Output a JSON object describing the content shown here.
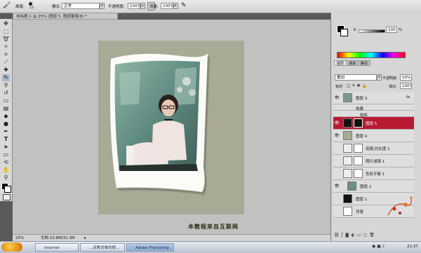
{
  "options_bar": {
    "brush_label": "画笔:",
    "brush_size": "13",
    "mode_label": "模式:",
    "mode_value": "正常",
    "opacity_label": "不透明度:",
    "opacity_value": "100%",
    "flow_label": "流量:",
    "flow_value": "100%"
  },
  "document": {
    "tab_title": "未标题-1 @ 25% (图层 5, 图层蒙版/8) *",
    "zoom": "25%",
    "doc_info": "文档:10.8M/31.3M",
    "watermark": "本教程来自互联网"
  },
  "color_panel": {
    "k_label": "K",
    "k_value": "100",
    "percent": "%"
  },
  "layers_panel": {
    "tabs": [
      "图层",
      "通道",
      "路径"
    ],
    "blend_mode": "叠加",
    "opacity_label": "不透明度:",
    "opacity_value": "50%",
    "lock_label": "锁定:",
    "fill_label": "填充:",
    "fill_value": "100%",
    "fx_label": "fx",
    "layers": [
      {
        "name": "图层 3",
        "thumb_color": "#7a9a8a"
      },
      {
        "name": "效果",
        "sub": true
      },
      {
        "name": "投影",
        "sub": true
      },
      {
        "name": "图层 5",
        "thumb_color": "#111111",
        "selected": true
      },
      {
        "name": "图层 4",
        "thumb_color": "#a8aa96"
      },
      {
        "name": "亮度/对比度 1",
        "thumb_color": "#ffffff"
      },
      {
        "name": "照片滤镜 1",
        "thumb_color": "#ffffff"
      },
      {
        "name": "色彩平衡 1",
        "thumb_color": "#ffffff"
      },
      {
        "name": "图层 2",
        "thumb_color": "#6f8f86"
      },
      {
        "name": "图层 1",
        "thumb_color": "#111111"
      },
      {
        "name": "背景",
        "thumb_color": "#ffffff"
      }
    ]
  },
  "taskbar": {
    "items": [
      {
        "label": "Internet"
      },
      {
        "label": "...对焦对象的修..."
      },
      {
        "label": "Adobe Photoshop"
      }
    ],
    "clock": "21:37"
  },
  "colors": {
    "selected_layer": "#b81a33",
    "document_bg": "#a8aa96"
  }
}
